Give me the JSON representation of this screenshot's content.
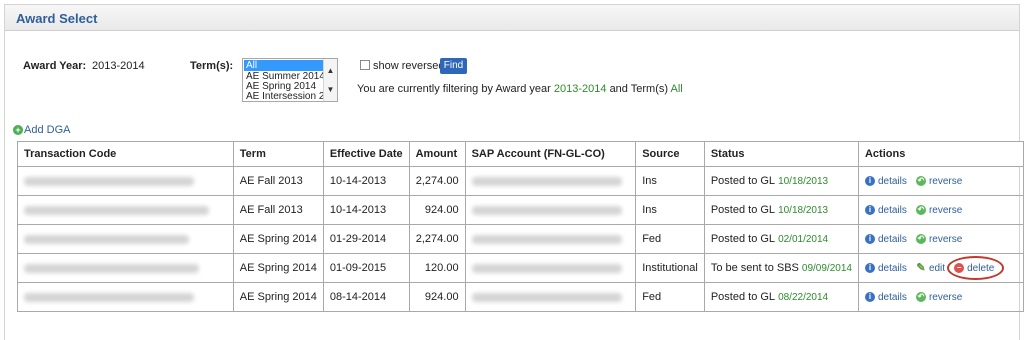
{
  "header": {
    "title": "Award Select"
  },
  "filters": {
    "award_year_label": "Award Year:",
    "award_year_value": "2013-2014",
    "terms_label": "Term(s):",
    "term_options": [
      "All",
      "AE Summer 2014",
      "AE Spring 2014",
      "AE Intersession 2("
    ],
    "selected_term": "All",
    "show_reversed_label": "show reversed",
    "show_reversed_checked": false,
    "find_label": "Find",
    "filter_prefix": "You are currently filtering by Award year",
    "filter_year": "2013-2014",
    "filter_mid": "and Term(s)",
    "filter_terms": "All"
  },
  "add_dga_label": "Add DGA",
  "table": {
    "columns": [
      "Transaction Code",
      "Term",
      "Effective Date",
      "Amount",
      "SAP Account (FN-GL-CO)",
      "Source",
      "Status",
      "Actions"
    ],
    "rows": [
      {
        "term": "AE Fall 2013",
        "effective_date": "10-14-2013",
        "amount": "2,274.00",
        "source": "Ins",
        "status": "Posted to GL",
        "status_date": "10/18/2013",
        "actions": [
          "details",
          "reverse"
        ]
      },
      {
        "term": "AE Fall 2013",
        "effective_date": "10-14-2013",
        "amount": "924.00",
        "source": "Ins",
        "status": "Posted to GL",
        "status_date": "10/18/2013",
        "actions": [
          "details",
          "reverse"
        ]
      },
      {
        "term": "AE Spring 2014",
        "effective_date": "01-29-2014",
        "amount": "2,274.00",
        "source": "Fed",
        "status": "Posted to GL",
        "status_date": "02/01/2014",
        "actions": [
          "details",
          "reverse"
        ]
      },
      {
        "term": "AE Spring 2014",
        "effective_date": "01-09-2015",
        "amount": "120.00",
        "source": "Institutional",
        "status": "To be sent to SBS",
        "status_date": "09/09/2014",
        "actions": [
          "details",
          "edit",
          "delete"
        ]
      },
      {
        "term": "AE Spring 2014",
        "effective_date": "08-14-2014",
        "amount": "924.00",
        "source": "Fed",
        "status": "Posted to GL",
        "status_date": "08/22/2014",
        "actions": [
          "details",
          "reverse"
        ]
      }
    ]
  },
  "colors": {
    "accent": "#2f67b8",
    "title": "#2f5f9a",
    "status_date": "#2e8b2e",
    "highlight": "#c0392b"
  },
  "icons": {
    "details": "info-icon",
    "reverse": "reverse-arrow-icon",
    "edit": "pencil-icon",
    "delete": "minus-circle-icon",
    "add": "plus-circle-icon"
  }
}
